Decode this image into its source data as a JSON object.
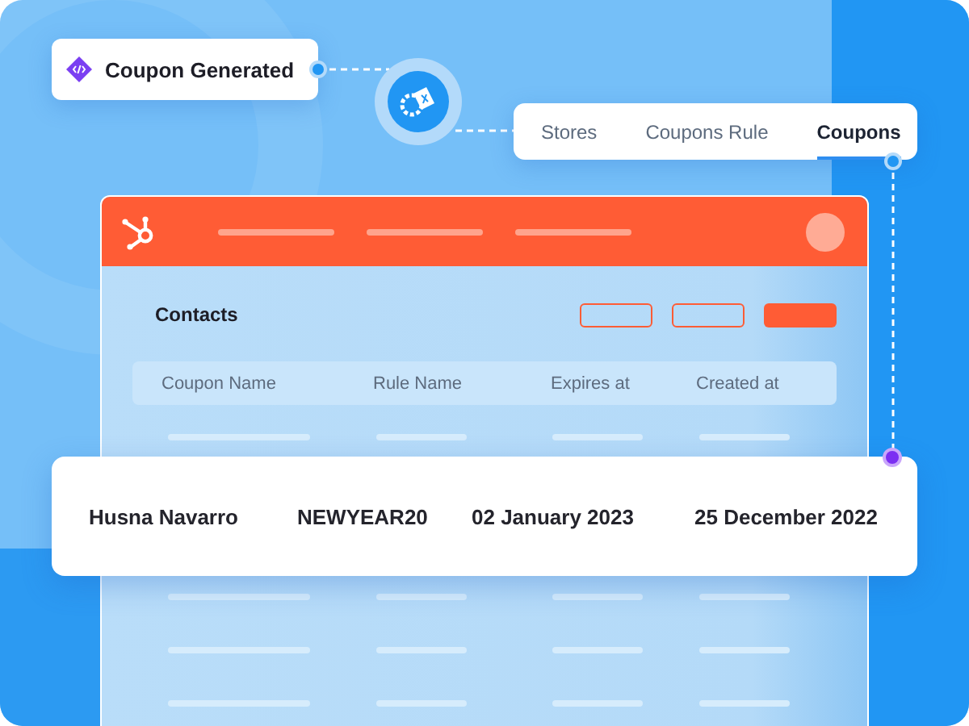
{
  "event_card": {
    "title": "Coupon Generated"
  },
  "tabs": [
    {
      "label": "Stores",
      "selected": false
    },
    {
      "label": "Coupons Rule",
      "selected": false
    },
    {
      "label": "Coupons",
      "selected": true
    }
  ],
  "app": {
    "section_title": "Contacts",
    "table": {
      "columns": [
        "Coupon Name",
        "Rule Name",
        "Expires at",
        "Created at"
      ]
    }
  },
  "highlighted_row": {
    "cells": [
      "Husna Navarro",
      "NEWYEAR20",
      "02 January 2023",
      "25 December 2022"
    ]
  }
}
